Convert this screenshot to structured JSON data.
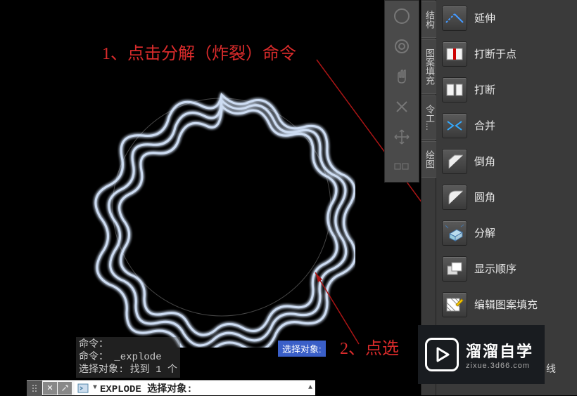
{
  "annotations": {
    "step1": "1、点击分解（炸裂）命令",
    "step2": "2、点选"
  },
  "cmd_history": {
    "line1": "命令：",
    "line2": "命令： _explode",
    "line3": "选择对象: 找到 1 个"
  },
  "select_prompt": "选择对象:",
  "cmd_input": {
    "text": "EXPLODE 选择对象:"
  },
  "side_tabs": {
    "structure": "结构",
    "pattern_fill": "图案填充",
    "cmd": "令工...",
    "draw": "绘图"
  },
  "tools": [
    {
      "id": "extend",
      "label": "延伸"
    },
    {
      "id": "break-at-point",
      "label": "打断于点"
    },
    {
      "id": "break",
      "label": "打断"
    },
    {
      "id": "join",
      "label": "合并"
    },
    {
      "id": "chamfer",
      "label": "倒角"
    },
    {
      "id": "fillet",
      "label": "圆角"
    },
    {
      "id": "explode",
      "label": "分解"
    },
    {
      "id": "draw-order",
      "label": "显示顺序"
    },
    {
      "id": "edit-hatch",
      "label": "编辑图案填充"
    }
  ],
  "watermark": {
    "title": "溜溜自学",
    "sub": "zixue.3d66.com"
  },
  "edge_label": "线"
}
